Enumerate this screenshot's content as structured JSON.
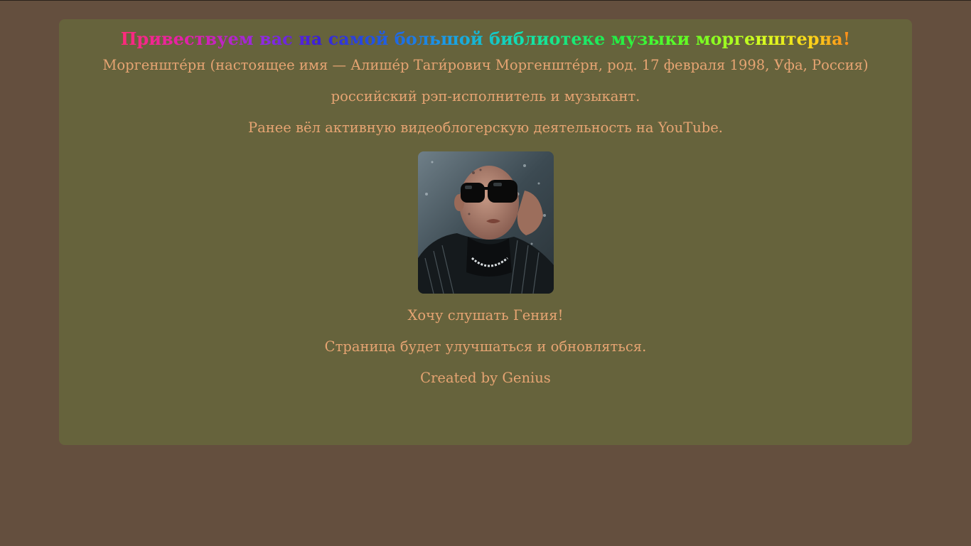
{
  "header": {
    "title": "Привествуем вас на самой большой библиотеке музыки моргенштерна!"
  },
  "bio": {
    "line1": "Моргенште́рн (настоящее имя — Алише́р Таги́рович Моргенште́рн, род. 17 февраля 1998, Уфа, Россия)",
    "line2": "российский рэп-исполнитель и музыкант.",
    "line3": "Ранее вёл активную видеоблогерскую деятельность на YouTube."
  },
  "links": {
    "listen": "Хочу слушать Гения!"
  },
  "footer": {
    "notice": "Страница будет улучшаться и обновляться.",
    "credit": "Created by Genius"
  },
  "colors": {
    "page_background": "#644f3e",
    "panel_background": "#66633c",
    "text": "#e6a472"
  },
  "image": {
    "subject": "portrait-photo"
  }
}
